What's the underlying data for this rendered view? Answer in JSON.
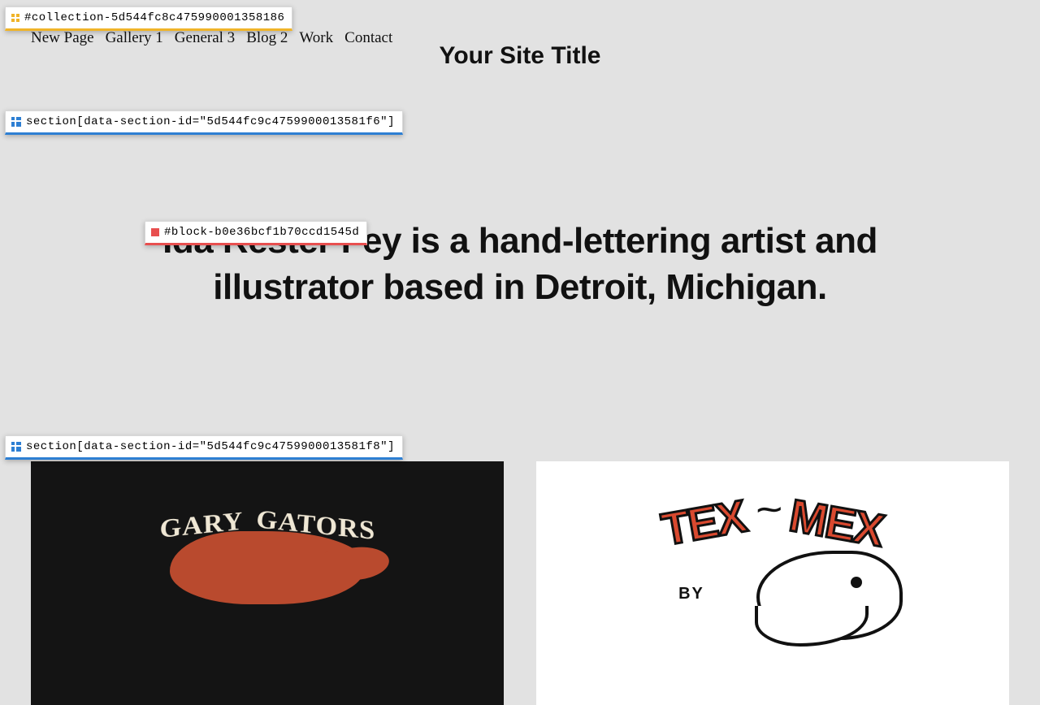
{
  "inspector": {
    "collection": {
      "label": "#collection-5d544fc8c475990001358186"
    },
    "section1": {
      "label": "section[data-section-id=\"5d544fc9c4759900013581f6\"]"
    },
    "block": {
      "label": "#block-b0e36bcf1b70ccd1545d"
    },
    "section2": {
      "label": "section[data-section-id=\"5d544fc9c4759900013581f8\"]"
    }
  },
  "nav": {
    "items": [
      "New Page",
      "Gallery 1",
      "General 3",
      "Blog 2",
      "Work",
      "Contact"
    ]
  },
  "site": {
    "title": "Your Site Title"
  },
  "hero": {
    "text": "Ida Rester Fey is a hand-lettering artist and illustrator based in Detroit, Michigan."
  },
  "gallery": {
    "card1": {
      "title_w1": "GARY",
      "title_w2": "GATORS"
    },
    "card2": {
      "tex": "TEX",
      "dash": "⁓",
      "mex": "MEX",
      "sub": "BY"
    }
  }
}
